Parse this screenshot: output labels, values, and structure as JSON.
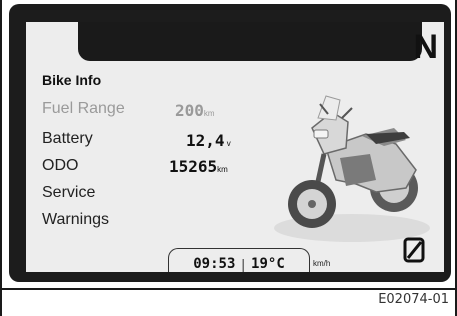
{
  "display": {
    "gear": "N",
    "heading": "Bike Info",
    "rows": [
      {
        "label": "Fuel Range",
        "value": "200",
        "unit": "km"
      },
      {
        "label": "Battery",
        "value": "12,4",
        "unit": "v"
      },
      {
        "label": "ODO",
        "value": "15265",
        "unit": "km"
      },
      {
        "label": "Service",
        "value": "",
        "unit": ""
      },
      {
        "label": "Warnings",
        "value": "",
        "unit": ""
      }
    ],
    "status": {
      "time": "09:53",
      "separator": "|",
      "temperature": "19°C",
      "speed_unit": "km/h"
    },
    "icons": {
      "speed_icon": "zero-digit-icon",
      "bike_image": "motorcycle-image"
    }
  },
  "caption": "E02074-01"
}
